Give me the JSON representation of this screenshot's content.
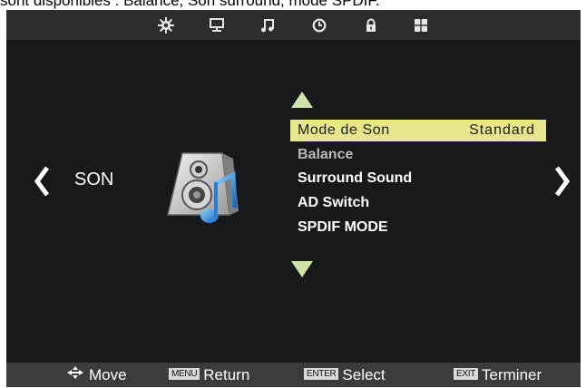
{
  "caption": "sont disponibles : Balance, Son surround, mode SPDIF.",
  "tabs": [
    {
      "icon": "picture-settings-icon"
    },
    {
      "icon": "monitor-icon"
    },
    {
      "icon": "music-note-icon"
    },
    {
      "icon": "clock-icon"
    },
    {
      "icon": "lock-icon"
    },
    {
      "icon": "grid-icon"
    }
  ],
  "section": {
    "title": "SON"
  },
  "menu": {
    "items": [
      {
        "label": "Mode de Son",
        "value": "Standard",
        "selected": true
      },
      {
        "label": "Balance",
        "disabled": true
      },
      {
        "label": "Surround Sound"
      },
      {
        "label": "AD Switch"
      },
      {
        "label": "SPDIF MODE"
      }
    ]
  },
  "footer": {
    "move": "Move",
    "menu_key": "MENU",
    "return": "Return",
    "enter_key": "ENTER",
    "select": "Select",
    "exit_key": "EXIT",
    "exit": "Terminer"
  },
  "colors": {
    "highlight": "#e8e68a",
    "triangle": "#cfe3a8",
    "background": "#17191b"
  }
}
